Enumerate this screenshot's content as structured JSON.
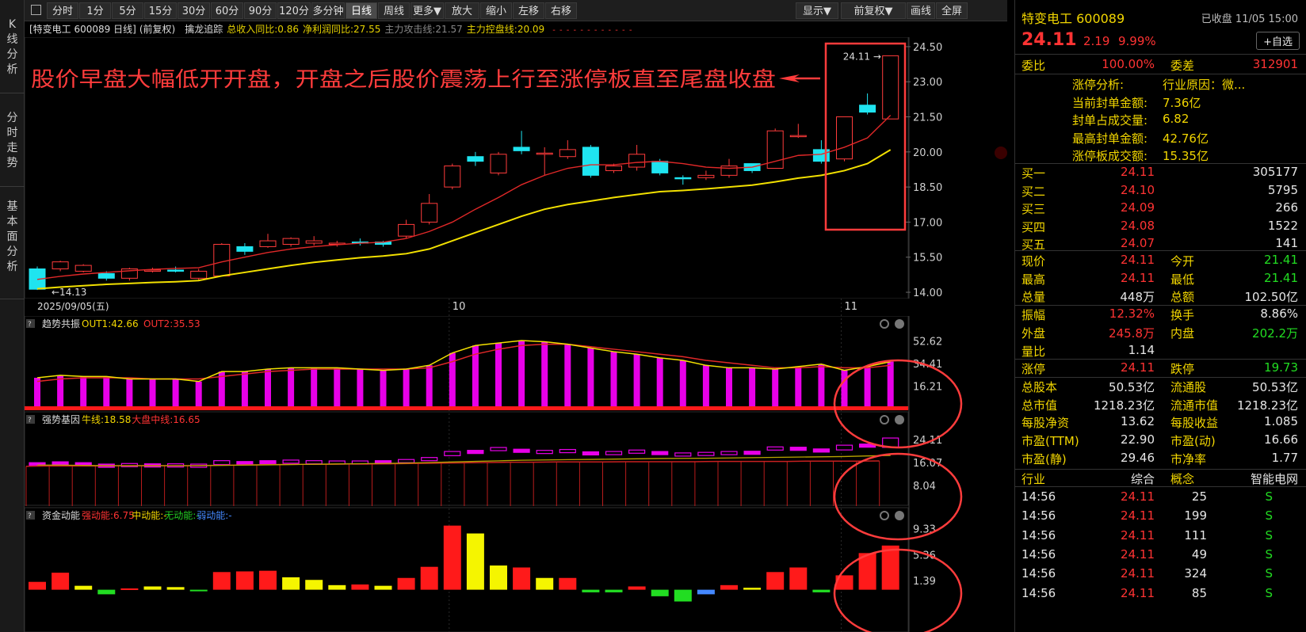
{
  "left_tabs": [
    {
      "label": "K线分析"
    },
    {
      "label": "分时走势"
    },
    {
      "label": "基本面分析"
    }
  ],
  "toolbar": {
    "buttons": [
      "分时",
      "1分",
      "5分",
      "15分",
      "30分",
      "60分",
      "90分",
      "120分",
      "多分钟",
      "日线",
      "周线",
      "更多▼",
      "放大",
      "缩小",
      "左移",
      "右移"
    ],
    "active": "日线",
    "right_buttons": [
      "显示▼",
      "前复权▼",
      "画线",
      "全屏"
    ]
  },
  "infobar": {
    "title": "[特变电工 600089 日线]",
    "adjust": "(前复权)",
    "indicator": "擒龙追踪",
    "items": [
      {
        "text": "总收入同比:0.86",
        "color": "#e6d200"
      },
      {
        "text": "净利润同比:27.55",
        "color": "#e6d200"
      },
      {
        "text": "主力攻击线:21.57",
        "color": "#888888"
      },
      {
        "text": "主力控盘线:20.09",
        "color": "#e6d200"
      }
    ],
    "marks": "- - - - - - - - - - - -"
  },
  "annotation": "股价早盘大幅低开开盘，开盘之后股价震荡上行至涨停板直至尾盘收盘",
  "main_chart": {
    "start_date": "2025/09/05(五)",
    "month_labels": [
      "10",
      "11"
    ],
    "y_ticks": [
      "24.50",
      "23.00",
      "21.50",
      "20.00",
      "18.50",
      "17.00",
      "15.50",
      "14.00"
    ],
    "low_label": "14.13",
    "high_label": "24.11"
  },
  "chart_data": {
    "type": "candlestick",
    "candles": [
      [
        15.0,
        14.13,
        15.1,
        14.1
      ],
      [
        15.0,
        15.3,
        15.35,
        14.9
      ],
      [
        14.9,
        15.15,
        15.2,
        14.85
      ],
      [
        14.8,
        14.6,
        14.9,
        14.5
      ],
      [
        14.6,
        15.0,
        15.05,
        14.5
      ],
      [
        14.9,
        14.95,
        15.05,
        14.85
      ],
      [
        14.95,
        14.9,
        15.1,
        14.85
      ],
      [
        14.6,
        14.9,
        15.0,
        14.5
      ],
      [
        14.7,
        16.05,
        16.1,
        14.7
      ],
      [
        15.95,
        15.75,
        16.1,
        15.6
      ],
      [
        15.95,
        16.2,
        16.5,
        15.9
      ],
      [
        16.05,
        16.3,
        16.35,
        15.95
      ],
      [
        16.1,
        16.2,
        16.4,
        16.0
      ],
      [
        16.05,
        16.1,
        16.2,
        15.95
      ],
      [
        16.15,
        16.1,
        16.3,
        16.0
      ],
      [
        16.15,
        16.05,
        16.2,
        15.95
      ],
      [
        16.4,
        16.9,
        17.1,
        16.3
      ],
      [
        17.0,
        17.8,
        18.2,
        16.9
      ],
      [
        18.5,
        19.4,
        19.5,
        18.4
      ],
      [
        19.8,
        19.6,
        20.0,
        19.4
      ],
      [
        19.1,
        19.9,
        20.0,
        19.0
      ],
      [
        20.2,
        20.05,
        20.9,
        19.9
      ],
      [
        19.95,
        19.95,
        20.2,
        19.0
      ],
      [
        19.8,
        20.1,
        20.5,
        19.7
      ],
      [
        20.2,
        19.0,
        20.3,
        18.9
      ],
      [
        19.2,
        19.4,
        19.5,
        19.1
      ],
      [
        19.35,
        19.9,
        20.3,
        19.2
      ],
      [
        19.6,
        19.1,
        19.7,
        19.0
      ],
      [
        18.9,
        18.85,
        19.0,
        18.6
      ],
      [
        18.9,
        19.0,
        19.2,
        18.8
      ],
      [
        19.0,
        19.4,
        19.7,
        18.9
      ],
      [
        19.5,
        19.2,
        19.5,
        19.1
      ],
      [
        19.3,
        20.9,
        21.0,
        19.3
      ],
      [
        20.7,
        20.7,
        21.2,
        20.6
      ],
      [
        20.1,
        19.6,
        20.5,
        19.5
      ],
      [
        19.7,
        21.5,
        21.5,
        19.6
      ],
      [
        22.0,
        21.7,
        22.5,
        21.6
      ],
      [
        21.41,
        24.11,
        24.11,
        21.41
      ]
    ],
    "ma_red": [
      14.55,
      14.68,
      14.78,
      14.85,
      14.92,
      14.98,
      15.02,
      15.05,
      15.3,
      15.5,
      15.7,
      15.85,
      15.95,
      16.03,
      16.1,
      16.14,
      16.3,
      16.6,
      17.0,
      17.55,
      18.05,
      18.6,
      19.0,
      19.3,
      19.45,
      19.45,
      19.55,
      19.6,
      19.5,
      19.35,
      19.3,
      19.35,
      19.6,
      19.85,
      19.9,
      20.2,
      20.6,
      21.57
    ],
    "ma_yellow": [
      14.15,
      14.22,
      14.28,
      14.34,
      14.38,
      14.42,
      14.45,
      14.5,
      14.7,
      14.85,
      15.0,
      15.15,
      15.28,
      15.38,
      15.48,
      15.55,
      15.65,
      15.85,
      16.2,
      16.55,
      16.9,
      17.25,
      17.55,
      17.75,
      17.9,
      18.05,
      18.18,
      18.3,
      18.35,
      18.42,
      18.5,
      18.58,
      18.72,
      18.88,
      19.0,
      19.2,
      19.5,
      20.09
    ],
    "panels": [
      {
        "title": "趋势共振",
        "legend": [
          {
            "text": "OUT1:42.66",
            "color": "#f2d600"
          },
          {
            "text": "OUT2:35.53",
            "color": "#ff3333"
          }
        ],
        "y_ticks": [
          "52.62",
          "34.41",
          "16.21"
        ],
        "ymin": 0,
        "ymax": 60,
        "bars": [
          23,
          25,
          24,
          24,
          22,
          22,
          22,
          20,
          28,
          28,
          30,
          31,
          31,
          31,
          30,
          29,
          30,
          33,
          43,
          49,
          51,
          53,
          52,
          50,
          47,
          44,
          42,
          39,
          37,
          33,
          31,
          31,
          30,
          32,
          34,
          29,
          32,
          36,
          42.66
        ],
        "line1": [
          23,
          25,
          24,
          24,
          22,
          22,
          22,
          20,
          28,
          28,
          30,
          31,
          31,
          31,
          30,
          29,
          30,
          33,
          43,
          49,
          51,
          53,
          52,
          50,
          47,
          44,
          42,
          39,
          37,
          33,
          31,
          31,
          30,
          32,
          34,
          29,
          32,
          36,
          42.66
        ],
        "line2": [
          20,
          22,
          23,
          23,
          23,
          22,
          22,
          22,
          24,
          26,
          28,
          29,
          30,
          30,
          30,
          30,
          30,
          31,
          36,
          42,
          46,
          49,
          50,
          50,
          48,
          46,
          44,
          42,
          40,
          37,
          35,
          33,
          31,
          31,
          32,
          31,
          31,
          33,
          35.53
        ]
      },
      {
        "title": "强势基因",
        "legend": [
          {
            "text": "牛线:18.58",
            "color": "#f2d600"
          },
          {
            "text": "大盘中线:16.65",
            "color": "#ff3333"
          }
        ],
        "y_ticks": [
          "24.11",
          "16.07",
          "8.04"
        ],
        "ymin": 2,
        "ymax": 28,
        "candles": [
          [
            15.5,
            15.0
          ],
          [
            15.8,
            15.1
          ],
          [
            15.5,
            14.9
          ],
          [
            15.0,
            14.6
          ],
          [
            15.2,
            15.2
          ],
          [
            15.1,
            14.9
          ],
          [
            15.1,
            15.1
          ],
          [
            15.0,
            15.0
          ],
          [
            15.4,
            16.2
          ],
          [
            15.9,
            15.6
          ],
          [
            16.2,
            16.1
          ],
          [
            16.4,
            16.4
          ],
          [
            16.2,
            16.2
          ],
          [
            16.1,
            16.1
          ],
          [
            16.1,
            16.1
          ],
          [
            16.2,
            16.1
          ],
          [
            16.4,
            16.6
          ],
          [
            17.0,
            17.3
          ],
          [
            18.5,
            19.4
          ],
          [
            19.8,
            19.6
          ],
          [
            20.6,
            20.8
          ],
          [
            20.2,
            20.05
          ],
          [
            19.7,
            19.8
          ],
          [
            19.9,
            20.1
          ],
          [
            19.3,
            19.1
          ],
          [
            19.4,
            19.4
          ],
          [
            19.4,
            19.9
          ],
          [
            19.4,
            19.3
          ],
          [
            18.9,
            18.9
          ],
          [
            18.9,
            19.1
          ],
          [
            19.1,
            19.4
          ],
          [
            19.5,
            19.2
          ],
          [
            20.5,
            21.0
          ],
          [
            20.9,
            20.8
          ],
          [
            20.3,
            19.9
          ],
          [
            20.5,
            21.6
          ],
          [
            22.0,
            21.7
          ],
          [
            21.4,
            24.11
          ]
        ],
        "line1": [
          15.2,
          15.2,
          15.1,
          15.0,
          15.0,
          15.0,
          15.0,
          15.0,
          15.1,
          15.2,
          15.3,
          15.4,
          15.5,
          15.6,
          15.7,
          15.8,
          15.9,
          16.1,
          16.3,
          16.5,
          16.7,
          16.9,
          17.0,
          17.1,
          17.2,
          17.3,
          17.4,
          17.5,
          17.55,
          17.6,
          17.7,
          17.8,
          17.9,
          18.0,
          18.1,
          18.2,
          18.4,
          18.58
        ],
        "line2": [
          14.8,
          14.9,
          14.9,
          14.9,
          15.0,
          15.0,
          15.0,
          15.0,
          15.1,
          15.2,
          15.3,
          15.4,
          15.5,
          15.5,
          15.6,
          15.6,
          15.7,
          15.8,
          15.9,
          16.0,
          16.1,
          16.2,
          16.2,
          16.3,
          16.3,
          16.3,
          16.4,
          16.4,
          16.4,
          16.4,
          16.5,
          16.5,
          16.5,
          16.5,
          16.6,
          16.6,
          16.6,
          16.65
        ]
      },
      {
        "title": "资金动能",
        "legend": [
          {
            "text": "强动能:6.75",
            "color": "#ff3333"
          },
          {
            "text": "中动能:-",
            "color": "#f2d600"
          },
          {
            "text": "无动能:-",
            "color": "#22cc22"
          },
          {
            "text": "弱动能:-",
            "color": "#4488ff"
          }
        ],
        "y_ticks": [
          "9.33",
          "5.36",
          "1.39"
        ],
        "ymin": -1.5,
        "ymax": 10,
        "bars": [
          [
            1.2,
            "r"
          ],
          [
            2.6,
            "r"
          ],
          [
            0.6,
            "y"
          ],
          [
            -0.7,
            "g"
          ],
          [
            0.2,
            "r"
          ],
          [
            0.5,
            "y"
          ],
          [
            0.4,
            "y"
          ],
          [
            -0.2,
            "g"
          ],
          [
            2.7,
            "r"
          ],
          [
            2.8,
            "r"
          ],
          [
            2.9,
            "r"
          ],
          [
            1.9,
            "y"
          ],
          [
            1.5,
            "y"
          ],
          [
            0.7,
            "y"
          ],
          [
            0.8,
            "r"
          ],
          [
            0.6,
            "y"
          ],
          [
            1.8,
            "r"
          ],
          [
            3.5,
            "r"
          ],
          [
            9.8,
            "r"
          ],
          [
            8.6,
            "y"
          ],
          [
            3.7,
            "y"
          ],
          [
            3.4,
            "r"
          ],
          [
            1.8,
            "y"
          ],
          [
            1.8,
            "r"
          ],
          [
            -0.4,
            "g"
          ],
          [
            -0.4,
            "g"
          ],
          [
            0.5,
            "r"
          ],
          [
            -1.0,
            "g"
          ],
          [
            -1.8,
            "g"
          ],
          [
            -0.7,
            "b"
          ],
          [
            0.7,
            "r"
          ],
          [
            0.3,
            "y"
          ],
          [
            2.7,
            "r"
          ],
          [
            3.4,
            "r"
          ],
          [
            -0.4,
            "g"
          ],
          [
            2.2,
            "r"
          ],
          [
            5.6,
            "r"
          ],
          [
            6.75,
            "r"
          ]
        ]
      }
    ]
  },
  "right_panel": {
    "stock_name": "特变电工 600089",
    "status": "已收盘 11/05 15:00",
    "price": "24.11",
    "change": "2.19",
    "pct": "9.99%",
    "watch": "+自选",
    "weibi_label": "委比",
    "weibi": "100.00%",
    "weicha_label": "委差",
    "weicha": "312901",
    "limit_info": [
      {
        "label": "涨停分析:",
        "value": "行业原因：微..."
      },
      {
        "label": "当前封单金额:",
        "value": "7.36亿"
      },
      {
        "label": "封单占成交量:",
        "value": "6.82"
      },
      {
        "label": "最高封单金额:",
        "value": "42.76亿"
      },
      {
        "label": "涨停板成交额:",
        "value": "15.35亿"
      }
    ],
    "bids": [
      {
        "label": "买一",
        "price": "24.11",
        "vol": "305177"
      },
      {
        "label": "买二",
        "price": "24.10",
        "vol": "5795"
      },
      {
        "label": "买三",
        "price": "24.09",
        "vol": "266"
      },
      {
        "label": "买四",
        "price": "24.08",
        "vol": "1522"
      },
      {
        "label": "买五",
        "price": "24.07",
        "vol": "141"
      }
    ],
    "quote_rows": [
      {
        "l1": "现价",
        "v1": "24.11",
        "c1": "red",
        "l2": "今开",
        "v2": "21.41",
        "c2": "grn"
      },
      {
        "l1": "最高",
        "v1": "24.11",
        "c1": "red",
        "l2": "最低",
        "v2": "21.41",
        "c2": "grn"
      },
      {
        "l1": "总量",
        "v1": "448万",
        "c1": "wht",
        "l2": "总额",
        "v2": "102.50亿",
        "c2": "wht"
      },
      {
        "l1": "振幅",
        "v1": "12.32%",
        "c1": "red",
        "l2": "换手",
        "v2": "8.86%",
        "c2": "wht"
      },
      {
        "l1": "外盘",
        "v1": "245.8万",
        "c1": "red",
        "l2": "内盘",
        "v2": "202.2万",
        "c2": "grn"
      },
      {
        "l1": "量比",
        "v1": "1.14",
        "c1": "wht",
        "l2": "",
        "v2": "",
        "c2": "wht"
      },
      {
        "l1": "涨停",
        "v1": "24.11",
        "c1": "red",
        "l2": "跌停",
        "v2": "19.73",
        "c2": "grn"
      },
      {
        "l1": "总股本",
        "v1": "50.53亿",
        "c1": "wht",
        "l2": "流通股",
        "v2": "50.53亿",
        "c2": "wht"
      },
      {
        "l1": "总市值",
        "v1": "1218.23亿",
        "c1": "wht",
        "l2": "流通市值",
        "v2": "1218.23亿",
        "c2": "wht"
      },
      {
        "l1": "每股净资",
        "v1": "13.62",
        "c1": "wht",
        "l2": "每股收益",
        "v2": "1.085",
        "c2": "wht"
      },
      {
        "l1": "市盈(TTM)",
        "v1": "22.90",
        "c1": "wht",
        "l2": "市盈(动)",
        "v2": "16.66",
        "c2": "wht"
      },
      {
        "l1": "市盈(静)",
        "v1": "29.46",
        "c1": "wht",
        "l2": "市净率",
        "v2": "1.77",
        "c2": "wht"
      }
    ],
    "category": {
      "l1": "行业",
      "v1": "综合",
      "l2": "概念",
      "v2": "智能电网"
    },
    "trades": [
      {
        "time": "14:56",
        "price": "24.11",
        "vol": "25",
        "side": "S"
      },
      {
        "time": "14:56",
        "price": "24.11",
        "vol": "199",
        "side": "S"
      },
      {
        "time": "14:56",
        "price": "24.11",
        "vol": "111",
        "side": "S"
      },
      {
        "time": "14:56",
        "price": "24.11",
        "vol": "49",
        "side": "S"
      },
      {
        "time": "14:56",
        "price": "24.11",
        "vol": "324",
        "side": "S"
      },
      {
        "time": "14:56",
        "price": "24.11",
        "vol": "85",
        "side": "S"
      }
    ]
  }
}
